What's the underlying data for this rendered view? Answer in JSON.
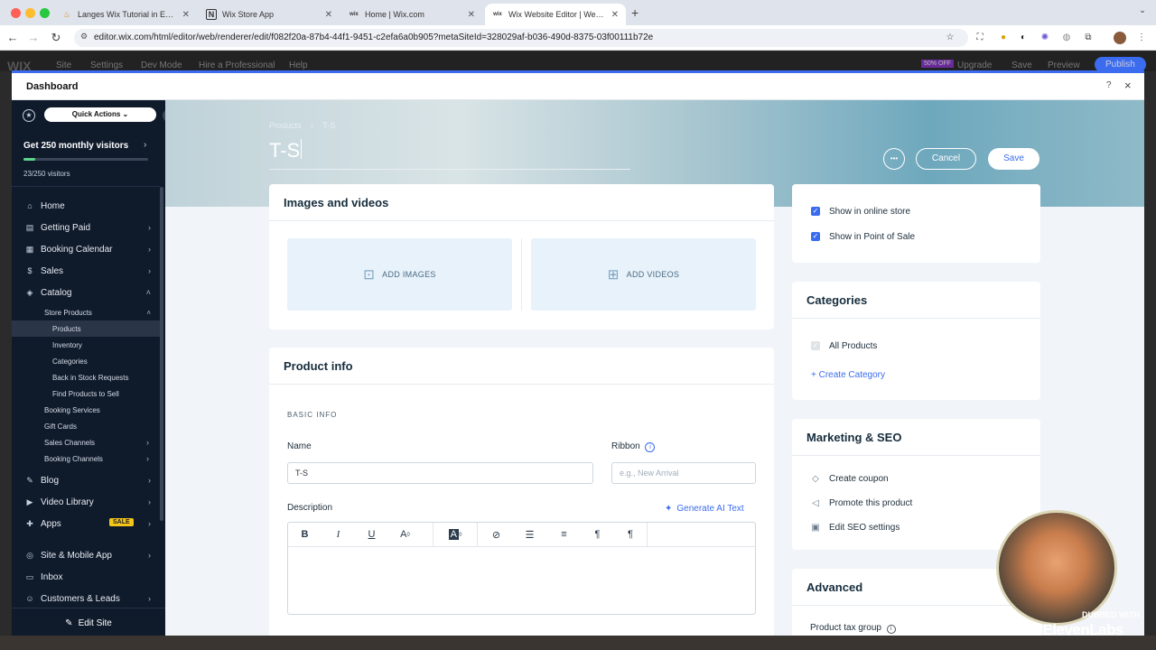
{
  "browser": {
    "tabs": [
      {
        "title": "Langes Wix Tutorial in Englis",
        "favicon": "flame-icon"
      },
      {
        "title": "Wix Store App",
        "favicon": "notion-icon"
      },
      {
        "title": "Home | Wix.com",
        "favicon": "wix-icon"
      },
      {
        "title": "Wix Website Editor | Website",
        "favicon": "wix-icon",
        "active": true
      }
    ],
    "new_tab": "+",
    "url": "editor.wix.com/html/editor/web/renderer/edit/f082f20a-87b4-44f1-9451-c2efa6a0b905?metaSiteId=328029af-b036-490d-8375-03f00111b72e"
  },
  "editor_bar": {
    "logo": "WIX",
    "items": [
      "Site",
      "Settings",
      "Dev Mode",
      "Hire a Professional",
      "Help"
    ],
    "badge": "50% OFF",
    "right": [
      "Upgrade",
      "Save",
      "Preview",
      "Publish"
    ]
  },
  "dashboard": {
    "title": "Dashboard",
    "help": "?",
    "close": "×"
  },
  "sidebar": {
    "quick_actions": "Quick Actions",
    "promo_title": "Get 250 monthly visitors",
    "promo_progress": 0.092,
    "promo_count": "23/250 visitors",
    "items": [
      {
        "label": "Home",
        "icon": "home-icon"
      },
      {
        "label": "Getting Paid",
        "icon": "wallet-icon"
      },
      {
        "label": "Booking Calendar",
        "icon": "calendar-icon"
      },
      {
        "label": "Sales",
        "icon": "dollar-icon"
      },
      {
        "label": "Catalog",
        "icon": "tag-icon"
      }
    ],
    "catalog_sub": {
      "store_products": "Store Products",
      "children": [
        "Products",
        "Inventory",
        "Categories",
        "Back in Stock Requests",
        "Find Products to Sell"
      ],
      "others": [
        "Booking Services",
        "Gift Cards",
        "Sales Channels",
        "Booking Channels"
      ]
    },
    "lower_items": [
      {
        "label": "Blog",
        "icon": "pen-icon"
      },
      {
        "label": "Video Library",
        "icon": "video-icon"
      },
      {
        "label": "Apps",
        "icon": "apps-icon",
        "badge": "SALE"
      },
      {
        "label": "Site & Mobile App",
        "icon": "globe-icon"
      },
      {
        "label": "Inbox",
        "icon": "inbox-icon"
      },
      {
        "label": "Customers & Leads",
        "icon": "people-icon"
      }
    ],
    "edit_site": "Edit Site"
  },
  "header": {
    "breadcrumb_root": "Products",
    "breadcrumb_current": "T-S",
    "title_value": "T-S",
    "more": "•••",
    "cancel": "Cancel",
    "save": "Save"
  },
  "media": {
    "title": "Images and videos",
    "add_images": "ADD IMAGES",
    "add_videos": "ADD VIDEOS"
  },
  "product_info": {
    "title": "Product info",
    "section": "BASIC INFO",
    "name_label": "Name",
    "name_value": "T-S",
    "ribbon_label": "Ribbon",
    "ribbon_placeholder": "e.g., New Arrival",
    "description_label": "Description",
    "generate_ai": "Generate AI Text"
  },
  "visibility": {
    "show_online": "Show in online store",
    "show_pos": "Show in Point of Sale"
  },
  "categories": {
    "title": "Categories",
    "all": "All Products",
    "create": "+ Create Category"
  },
  "marketing": {
    "title": "Marketing & SEO",
    "items": [
      "Create coupon",
      "Promote this product",
      "Edit SEO settings"
    ]
  },
  "advanced": {
    "title": "Advanced",
    "tax_group": "Product tax group"
  },
  "watermark": {
    "line1": "DUBBED WITH",
    "line2": "IIElevenLabs"
  }
}
